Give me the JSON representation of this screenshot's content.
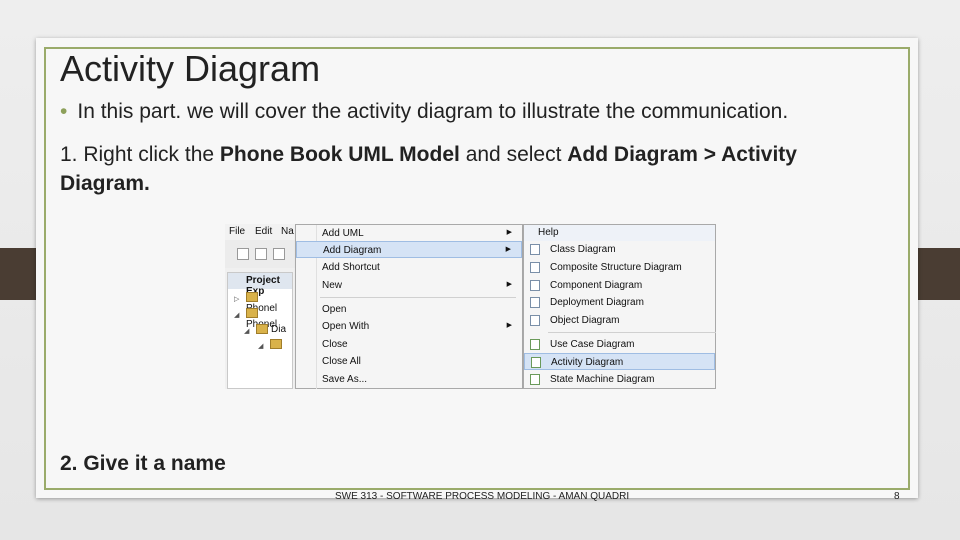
{
  "slide": {
    "title": "Activity Diagram",
    "bullet": "In this part. we will cover the activity diagram to illustrate the communication.",
    "step1": {
      "prefix": "1. Right click the ",
      "bold1": "Phone Book UML Model",
      "middle": " and select ",
      "bold2": "Add Diagram > Activity Diagram."
    },
    "step2": "2. Give it a name",
    "footer": "SWE 313 - SOFTWARE PROCESS MODELING - AMAN QUADRI",
    "page_number": "8"
  },
  "screenshot": {
    "menubar": [
      "File",
      "Edit",
      "Na"
    ],
    "project_explorer": {
      "title": "Project Exp",
      "rows": [
        "Phonel",
        "Phonel",
        "Dia"
      ]
    },
    "context_menu": [
      {
        "label": "Add UML",
        "submenu": true
      },
      {
        "label": "Add Diagram",
        "submenu": true,
        "highlighted": true
      },
      {
        "label": "Add Shortcut",
        "submenu": false
      },
      {
        "label": "New",
        "submenu": true
      },
      {
        "label": "Open",
        "submenu": false
      },
      {
        "label": "Open With",
        "submenu": true
      },
      {
        "label": "Close",
        "submenu": false
      },
      {
        "label": "Close All",
        "submenu": false
      },
      {
        "label": "Save As...",
        "submenu": false
      }
    ],
    "submenu_header": "Help",
    "submenu": [
      {
        "label": "Class Diagram"
      },
      {
        "label": "Composite Structure Diagram"
      },
      {
        "label": "Component Diagram"
      },
      {
        "label": "Deployment Diagram"
      },
      {
        "label": "Object Diagram"
      },
      {
        "label": "Use Case Diagram"
      },
      {
        "label": "Activity Diagram",
        "highlighted": true
      },
      {
        "label": "State Machine Diagram"
      }
    ],
    "colors": {
      "highlight": "#d5e3f5",
      "accent": "#8da05a",
      "border": "#9aab6a"
    }
  }
}
